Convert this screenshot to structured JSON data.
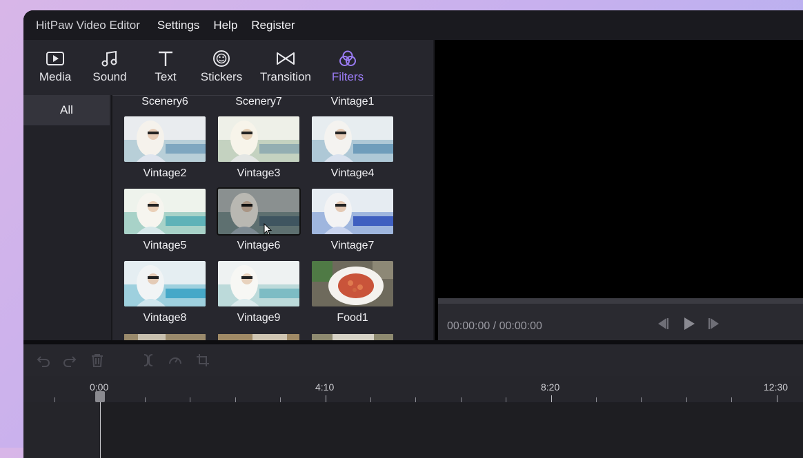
{
  "menubar": {
    "app_title": "HitPaw Video Editor",
    "items": [
      "Settings",
      "Help",
      "Register"
    ]
  },
  "tabs": [
    {
      "label": "Media",
      "icon": "media-icon",
      "active": false
    },
    {
      "label": "Sound",
      "icon": "music-note-icon",
      "active": false
    },
    {
      "label": "Text",
      "icon": "text-icon",
      "active": false
    },
    {
      "label": "Stickers",
      "icon": "sticker-icon",
      "active": false
    },
    {
      "label": "Transition",
      "icon": "transition-icon",
      "active": false
    },
    {
      "label": "Filters",
      "icon": "filters-icon",
      "active": true
    }
  ],
  "sidebar": {
    "items": [
      "All"
    ]
  },
  "filters": {
    "top_labels": [
      "Scenery6",
      "Scenery7",
      "Vintage1"
    ],
    "rows": [
      [
        "Vintage2",
        "Vintage3",
        "Vintage4"
      ],
      [
        "Vintage5",
        "Vintage6",
        "Vintage7"
      ],
      [
        "Vintage8",
        "Vintage9",
        "Food1"
      ]
    ],
    "selected": "Vintage6"
  },
  "player": {
    "time": "00:00:00 / 00:00:00"
  },
  "timeline": {
    "ruler_labels": [
      "0:00",
      "4:10",
      "8:20",
      "12:30"
    ]
  },
  "colors": {
    "accent": "#9b7cf5",
    "background": "#1b1b20"
  }
}
